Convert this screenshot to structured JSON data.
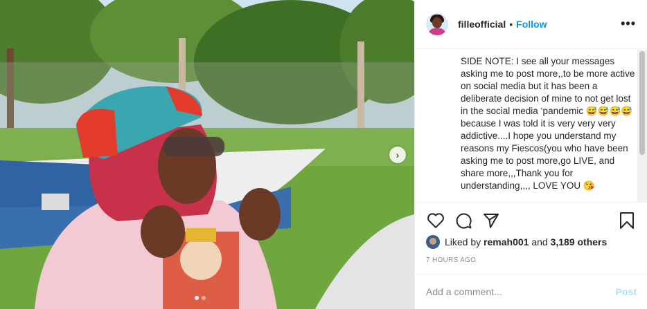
{
  "post": {
    "username": "filleofficial",
    "separator": "•",
    "follow_label": "Follow",
    "more_label": "•••"
  },
  "caption": {
    "text": "SIDE NOTE: I see all your messages asking me to post more,,to be more active on social media but it has been a deliberate decision of mine to not get lost in the social media ‘pandemic 😅😅😅😅 because I was told it is very very very addictive....I hope you understand my reasons my Fiescos(you who have been asking me to post more,go LIVE, and share more,,,Thank you for understanding,,,, LOVE YOU 😘"
  },
  "actions": {
    "like_icon": "heart-icon",
    "comment_icon": "comment-icon",
    "share_icon": "paper-plane-icon",
    "save_icon": "bookmark-icon"
  },
  "likes": {
    "prefix": "Liked by",
    "user": "remah001",
    "middle": "and",
    "count": "3,189 others"
  },
  "timestamp": "7 HOURS AGO",
  "comment": {
    "placeholder": "Add a comment...",
    "post_label": "Post"
  },
  "carousel": {
    "next_label": "›",
    "total_slides": 2,
    "active_slide": 1
  }
}
